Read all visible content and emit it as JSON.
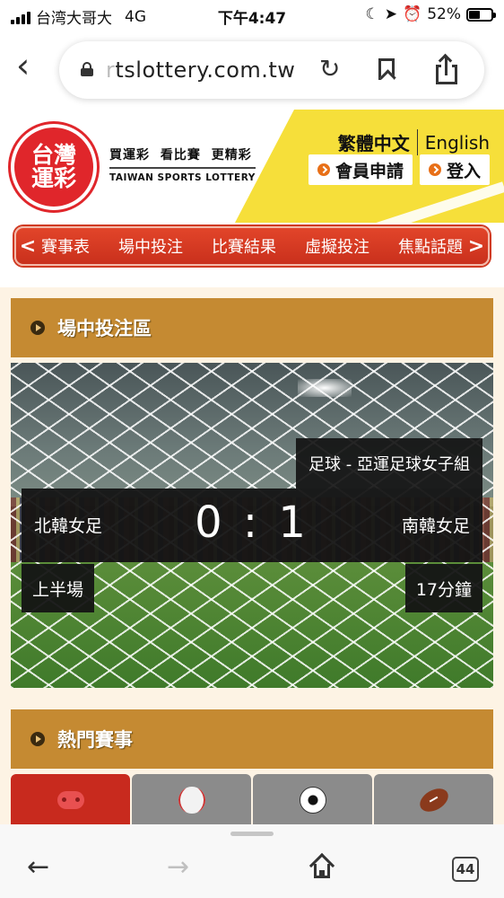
{
  "status_bar": {
    "carrier": "台湾大哥大",
    "network": "4G",
    "time": "下午4:47",
    "battery_text": "52%",
    "battery_level": 0.52
  },
  "browser": {
    "url_faded": "r",
    "url_main": "tslottery.com.tw",
    "open_tabs": "44"
  },
  "site": {
    "logo_line1": "台灣",
    "logo_line2": "運彩",
    "slogan": "買運彩 看比賽 更精彩",
    "slogan_en": "TAIWAN SPORTS LOTTERY",
    "lang_zh": "繁體中文",
    "lang_en": "English",
    "register_label": "會員申請",
    "login_label": "登入"
  },
  "nav": {
    "prev": "<",
    "next": ">",
    "items": [
      "賽事表",
      "場中投注",
      "比賽結果",
      "虛擬投注",
      "焦點話題"
    ]
  },
  "live_section": {
    "title": "場中投注區",
    "league": "足球 - 亞運足球女子組",
    "home_team": "北韓女足",
    "away_team": "南韓女足",
    "score": "0 : 1",
    "period": "上半場",
    "minute": "17分鐘"
  },
  "hot_section": {
    "title": "熱門賽事",
    "tabs": [
      {
        "icon": "esports-icon",
        "active": true
      },
      {
        "icon": "baseball-icon",
        "active": false
      },
      {
        "icon": "soccer-ball-icon",
        "active": false
      },
      {
        "icon": "american-football-icon",
        "active": false
      }
    ]
  },
  "colors": {
    "brand_red": "#e0262b",
    "nav_red": "#d03a22",
    "section_gold": "#c58a32",
    "header_yellow": "#f6df3a",
    "page_cream": "#fdf3e4"
  }
}
